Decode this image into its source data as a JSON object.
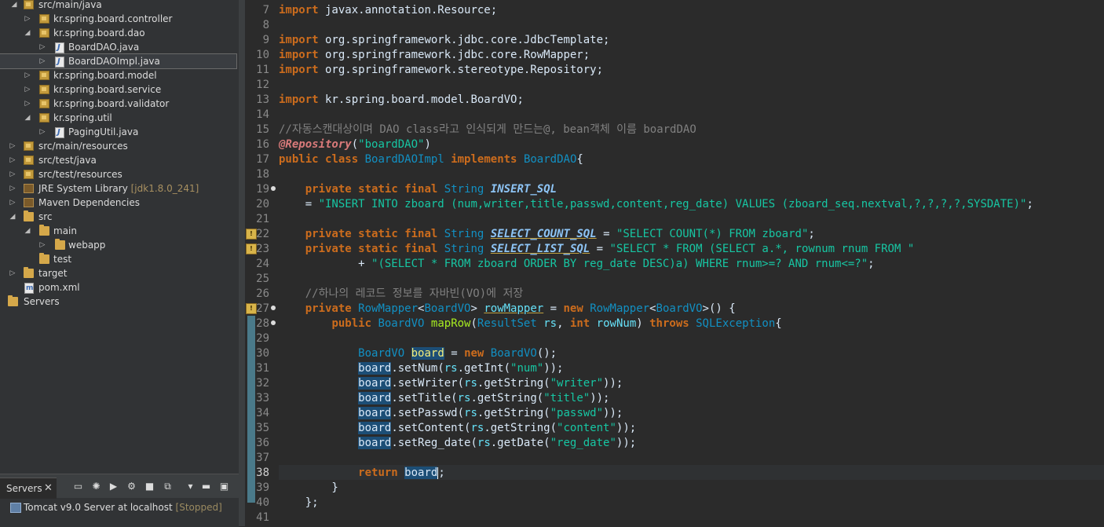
{
  "explorer": {
    "items": [
      {
        "label": "src/main/java",
        "suffix": ""
      },
      {
        "label": "kr.spring.board.controller",
        "suffix": ""
      },
      {
        "label": "kr.spring.board.dao",
        "suffix": ""
      },
      {
        "label": "BoardDAO.java",
        "suffix": ""
      },
      {
        "label": "BoardDAOImpl.java",
        "suffix": ""
      },
      {
        "label": "kr.spring.board.model",
        "suffix": ""
      },
      {
        "label": "kr.spring.board.service",
        "suffix": ""
      },
      {
        "label": "kr.spring.board.validator",
        "suffix": ""
      },
      {
        "label": "kr.spring.util",
        "suffix": ""
      },
      {
        "label": "PagingUtil.java",
        "suffix": ""
      },
      {
        "label": "src/main/resources",
        "suffix": ""
      },
      {
        "label": "src/test/java",
        "suffix": ""
      },
      {
        "label": "src/test/resources",
        "suffix": ""
      },
      {
        "label": "JRE System Library",
        "suffix": "[jdk1.8.0_241]"
      },
      {
        "label": "Maven Dependencies",
        "suffix": ""
      },
      {
        "label": "src",
        "suffix": ""
      },
      {
        "label": "main",
        "suffix": ""
      },
      {
        "label": "webapp",
        "suffix": ""
      },
      {
        "label": "test",
        "suffix": ""
      },
      {
        "label": "target",
        "suffix": ""
      },
      {
        "label": "pom.xml",
        "suffix": ""
      },
      {
        "label": "Servers",
        "suffix": ""
      }
    ]
  },
  "servers_view": {
    "tab_label": "Servers",
    "close_glyph": "✕",
    "server_name": "Tomcat v9.0 Server at localhost",
    "server_status": "[Stopped]"
  },
  "editor": {
    "line_numbers": [
      "7",
      "8",
      "9",
      "10",
      "11",
      "12",
      "13",
      "14",
      "15",
      "16",
      "17",
      "18",
      "19",
      "20",
      "21",
      "22",
      "23",
      "24",
      "25",
      "26",
      "27",
      "28",
      "29",
      "30",
      "31",
      "32",
      "33",
      "34",
      "35",
      "36",
      "37",
      "38",
      "39",
      "40",
      "41"
    ],
    "comment_1": "//자동스캔대상이며 DAO class라고 인식되게 만드는@, bean객체 이름 boardDAO",
    "comment_2": "//하나의 레코드 정보를 자바빈(VO)에 저장"
  },
  "colors": {
    "keyword": "#cc6c1d",
    "class": "#1290c3",
    "string": "#17c6a3",
    "comment": "#808080",
    "background": "#2b2b2b"
  }
}
